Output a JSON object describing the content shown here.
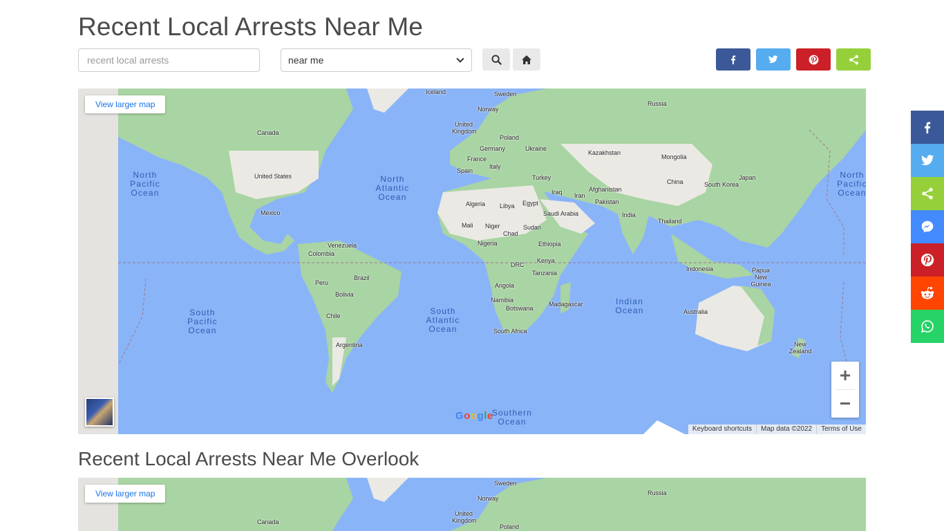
{
  "header": {
    "title": "Recent Local Arrests Near Me"
  },
  "search": {
    "placeholder": "recent local arrests",
    "select_value": "near me"
  },
  "toolbar": {
    "search_icon": "search-icon",
    "home_icon": "home-icon"
  },
  "share": {
    "facebook": {
      "icon": "facebook-icon",
      "color": "#3b5998"
    },
    "twitter": {
      "icon": "twitter-icon",
      "color": "#55acee"
    },
    "pinterest": {
      "icon": "pinterest-icon",
      "color": "#cb2027"
    },
    "sharethis": {
      "icon": "share-icon",
      "color": "#95d03a"
    }
  },
  "map": {
    "view_larger": "View larger map",
    "google": "Google",
    "footer": [
      "Keyboard shortcuts",
      "Map data ©2022",
      "Terms of Use"
    ],
    "countries": [
      "Iceland",
      "Sweden",
      "Russia",
      "Norway",
      "United Kingdom",
      "Poland",
      "Germany",
      "Ukraine",
      "France",
      "Kazakhstan",
      "Mongolia",
      "Italy",
      "Spain",
      "Turkey",
      "China",
      "South Korea",
      "Japan",
      "Iraq",
      "Afghanistan",
      "Iran",
      "Algeria",
      "Libya",
      "Egypt",
      "Pakistan",
      "Saudi Arabia",
      "India",
      "Mali",
      "Niger",
      "Chad",
      "Sudan",
      "Thailand",
      "Nigeria",
      "Ethiopia",
      "Venezuela",
      "Colombia",
      "Kenya",
      "DRC",
      "Indonesia",
      "Papua New Guinea",
      "Tanzania",
      "Peru",
      "Brazil",
      "Angola",
      "Bolivia",
      "Namibia",
      "Madagascar",
      "Botswana",
      "Australia",
      "Chile",
      "South Africa",
      "Argentina",
      "New Zealand",
      "Canada",
      "United States",
      "Mexico"
    ],
    "oceans": {
      "north_pacific_w": "North Pacific Ocean",
      "north_atlantic": "North Atlantic Ocean",
      "north_pacific_e": "North Pacific Ocean",
      "south_pacific": "South Pacific Ocean",
      "south_atlantic": "South Atlantic Ocean",
      "indian": "Indian Ocean",
      "southern": "Southern Ocean"
    }
  },
  "overlook": {
    "title": "Recent Local Arrests Near Me Overlook",
    "view_larger": "View larger map",
    "countries": [
      "Sweden",
      "Russia",
      "Norway",
      "Canada",
      "United Kingdom",
      "Poland"
    ]
  },
  "sidebar": [
    {
      "icon": "facebook-icon",
      "color": "#3b5998"
    },
    {
      "icon": "twitter-icon",
      "color": "#55acee"
    },
    {
      "icon": "share-icon",
      "color": "#95d03a"
    },
    {
      "icon": "messenger-icon",
      "color": "#448aff"
    },
    {
      "icon": "pinterest-icon",
      "color": "#cb2027"
    },
    {
      "icon": "reddit-icon",
      "color": "#ff4500"
    },
    {
      "icon": "whatsapp-icon",
      "color": "#25d366"
    }
  ]
}
